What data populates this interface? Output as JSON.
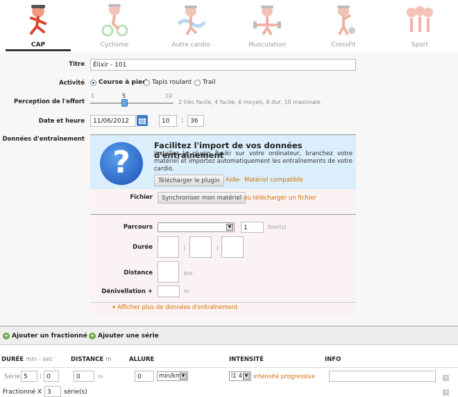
{
  "tabs": [
    {
      "label": "CAP",
      "active": true,
      "icon": "runner-icon"
    },
    {
      "label": "Cyclisme",
      "active": false,
      "icon": "cyclist-icon"
    },
    {
      "label": "Autre cardio",
      "active": false,
      "icon": "swimmer-icon"
    },
    {
      "label": "Musculation",
      "active": false,
      "icon": "weightlifter-icon"
    },
    {
      "label": "CrossFit",
      "active": false,
      "icon": "crossfit-icon"
    },
    {
      "label": "Sport",
      "active": false,
      "icon": "team-sport-icon"
    }
  ],
  "form": {
    "title_label": "Titre",
    "title_value": "Élixir - 101",
    "activity_label": "Activité",
    "activity_options": [
      "Course à pied",
      "Tapis roulant",
      "Trail"
    ],
    "effort_label": "Perception de l'effort",
    "effort_min": "1",
    "effort_value": "5",
    "effort_max": "10",
    "effort_hint": "2 très facile, 4 facile, 6 moyen, 8 dur, 10 maximale",
    "datetime_label": "Date et heure",
    "date_value": "11/06/2012",
    "hour_value": "10",
    "time_sep": ":",
    "minute_value": "36",
    "training_label": "Données d'entraînement"
  },
  "import": {
    "title": "Facilitez l'import de vos données d'entraînement",
    "text": "Installez le plugin Fysiki sur votre ordinateur, branchez votre matériel et importez automatiquement les entraînements de votre cardio.",
    "download_button": "Télécharger le plugin",
    "help_link": "Aide",
    "dash": " - ",
    "compat_link": "Matériel compatible"
  },
  "file": {
    "label": "Fichier",
    "sync_button": "Synchroniser mon matériel",
    "upload_link": "ou télécharger un fichier"
  },
  "details": {
    "route_label": "Parcours",
    "laps_value": "1",
    "laps_unit": "tour(s)",
    "duration_label": "Durée",
    "colon": ":",
    "distance_label": "Distance",
    "distance_unit": "km",
    "elevation_label": "Dénivellation +",
    "elevation_unit": "m",
    "more_link": "Afficher plus de données d'entraînement"
  },
  "intervals": {
    "add_interval": "Ajouter un fractionné",
    "add_series": "Ajouter une série",
    "headers": {
      "duration": "DURÉE",
      "duration_sub": "min - sec",
      "distance": "DISTANCE",
      "distance_sub": "m",
      "pace": "ALLURE",
      "intensity": "INTENSITÉ",
      "info": "INFO"
    },
    "row": {
      "label": "Série",
      "min": "5",
      "sep": ":",
      "sec": "0",
      "distance": "0",
      "distance_unit": "m",
      "pace": "0",
      "pace_unit": "min/km",
      "intensity": "i1 4",
      "progressive": "intensité progressive"
    },
    "repeat_label": "Fractionné X",
    "repeat_value": "3",
    "repeat_unit": "série(s)"
  },
  "colors": {
    "accent": "#d56f00",
    "import_bg": "#dbeefb",
    "panel_bg": "#fbf3f3"
  }
}
